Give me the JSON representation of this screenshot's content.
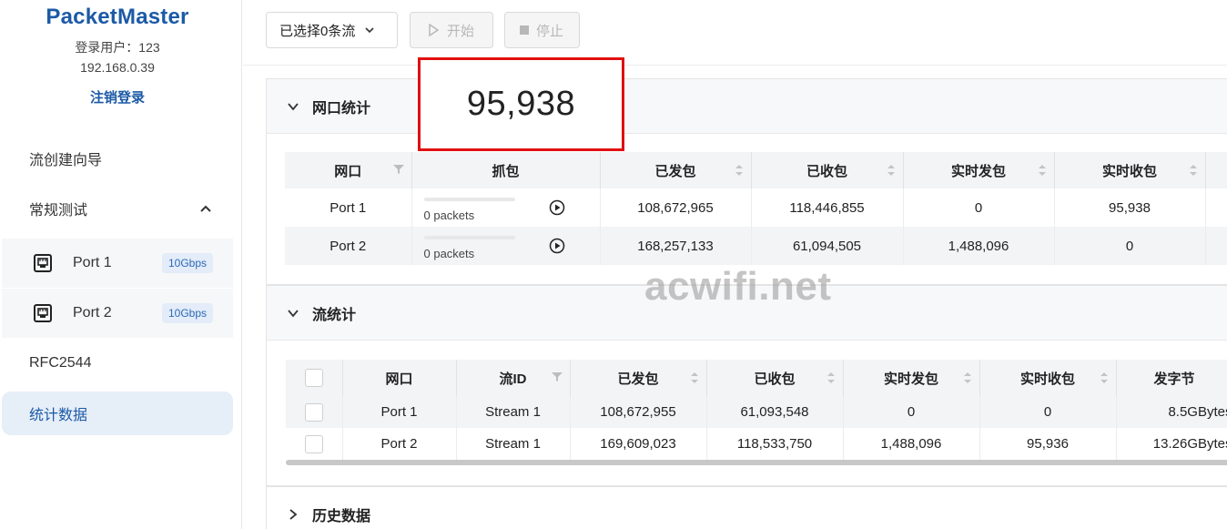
{
  "app": {
    "brand": "PacketMaster",
    "user_line": "登录用户：123",
    "ip": "192.168.0.39",
    "logout": "注销登录"
  },
  "sidebar": {
    "items": [
      {
        "label": "流创建向导"
      },
      {
        "label": "常规测试"
      },
      {
        "label": "RFC2544"
      },
      {
        "label": "统计数据"
      }
    ],
    "ports": [
      {
        "label": "Port 1",
        "speed": "10Gbps"
      },
      {
        "label": "Port 2",
        "speed": "10Gbps"
      }
    ]
  },
  "toolbar": {
    "select_label": "已选择0条流",
    "start_label": "开始",
    "stop_label": "停止"
  },
  "highlight": {
    "value": "95,938",
    "color": "#e01010"
  },
  "port_stats": {
    "title": "网口统计",
    "columns": [
      "网口",
      "抓包",
      "已发包",
      "已收包",
      "实时发包",
      "实时收包"
    ],
    "rows": [
      {
        "port": "Port 1",
        "capture": "0 packets",
        "sent": "108,672,965",
        "recv": "118,446,855",
        "rt_sent": "0",
        "rt_recv": "95,938"
      },
      {
        "port": "Port 2",
        "capture": "0 packets",
        "sent": "168,257,133",
        "recv": "61,094,505",
        "rt_sent": "1,488,096",
        "rt_recv": "0"
      }
    ]
  },
  "stream_stats": {
    "title": "流统计",
    "columns": [
      "网口",
      "流ID",
      "已发包",
      "已收包",
      "实时发包",
      "实时收包",
      "发字节"
    ],
    "rows": [
      {
        "port": "Port 1",
        "stream": "Stream 1",
        "sent": "108,672,955",
        "recv": "61,093,548",
        "rt_sent": "0",
        "rt_recv": "0",
        "bytes": "8.5GBytes"
      },
      {
        "port": "Port 2",
        "stream": "Stream 1",
        "sent": "169,609,023",
        "recv": "118,533,750",
        "rt_sent": "1,488,096",
        "rt_recv": "95,936",
        "bytes": "13.26GBytes"
      }
    ]
  },
  "history": {
    "title": "历史数据"
  },
  "watermark": "acwifi.net",
  "colors": {
    "brand": "#1c5aa6",
    "accent_bg": "#e6eef8",
    "badge_bg": "#e3ecf8"
  }
}
